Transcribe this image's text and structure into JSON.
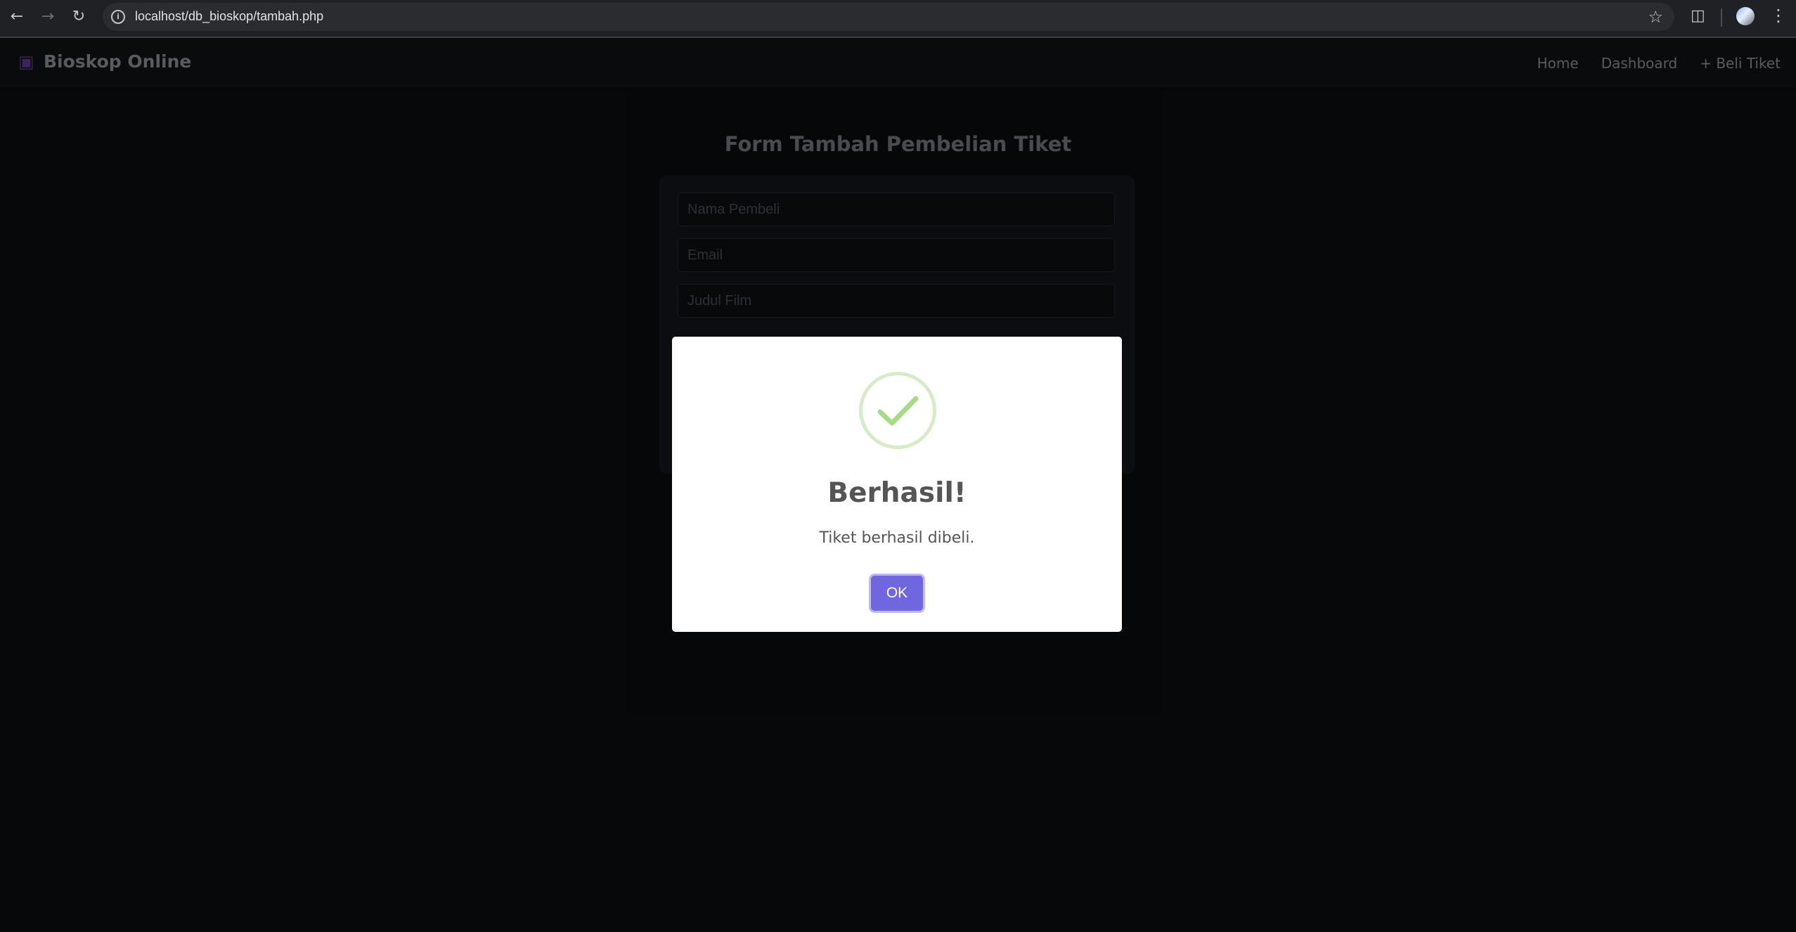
{
  "browser": {
    "url": "localhost/db_bioskop/tambah.php",
    "back_icon": "arrow-left-icon",
    "forward_icon": "arrow-right-icon",
    "reload_icon": "reload-icon"
  },
  "navbar": {
    "brand_icon": "clapperboard-icon",
    "brand": "Bioskop Online",
    "links": [
      "Home",
      "Dashboard",
      "+ Beli Tiket"
    ]
  },
  "form": {
    "title": "Form Tambah Pembelian Tiket",
    "fields": [
      {
        "placeholder": "Nama Pembeli",
        "value": ""
      },
      {
        "placeholder": "Email",
        "value": ""
      },
      {
        "placeholder": "Judul Film",
        "value": ""
      }
    ]
  },
  "modal": {
    "icon": "success-check-icon",
    "title": "Berhasil!",
    "text": "Tiket berhasil dibeli.",
    "ok_label": "OK"
  },
  "colors": {
    "page_bg": "#0b0d11",
    "accent": "#7067e0",
    "success": "#a5dc86"
  }
}
